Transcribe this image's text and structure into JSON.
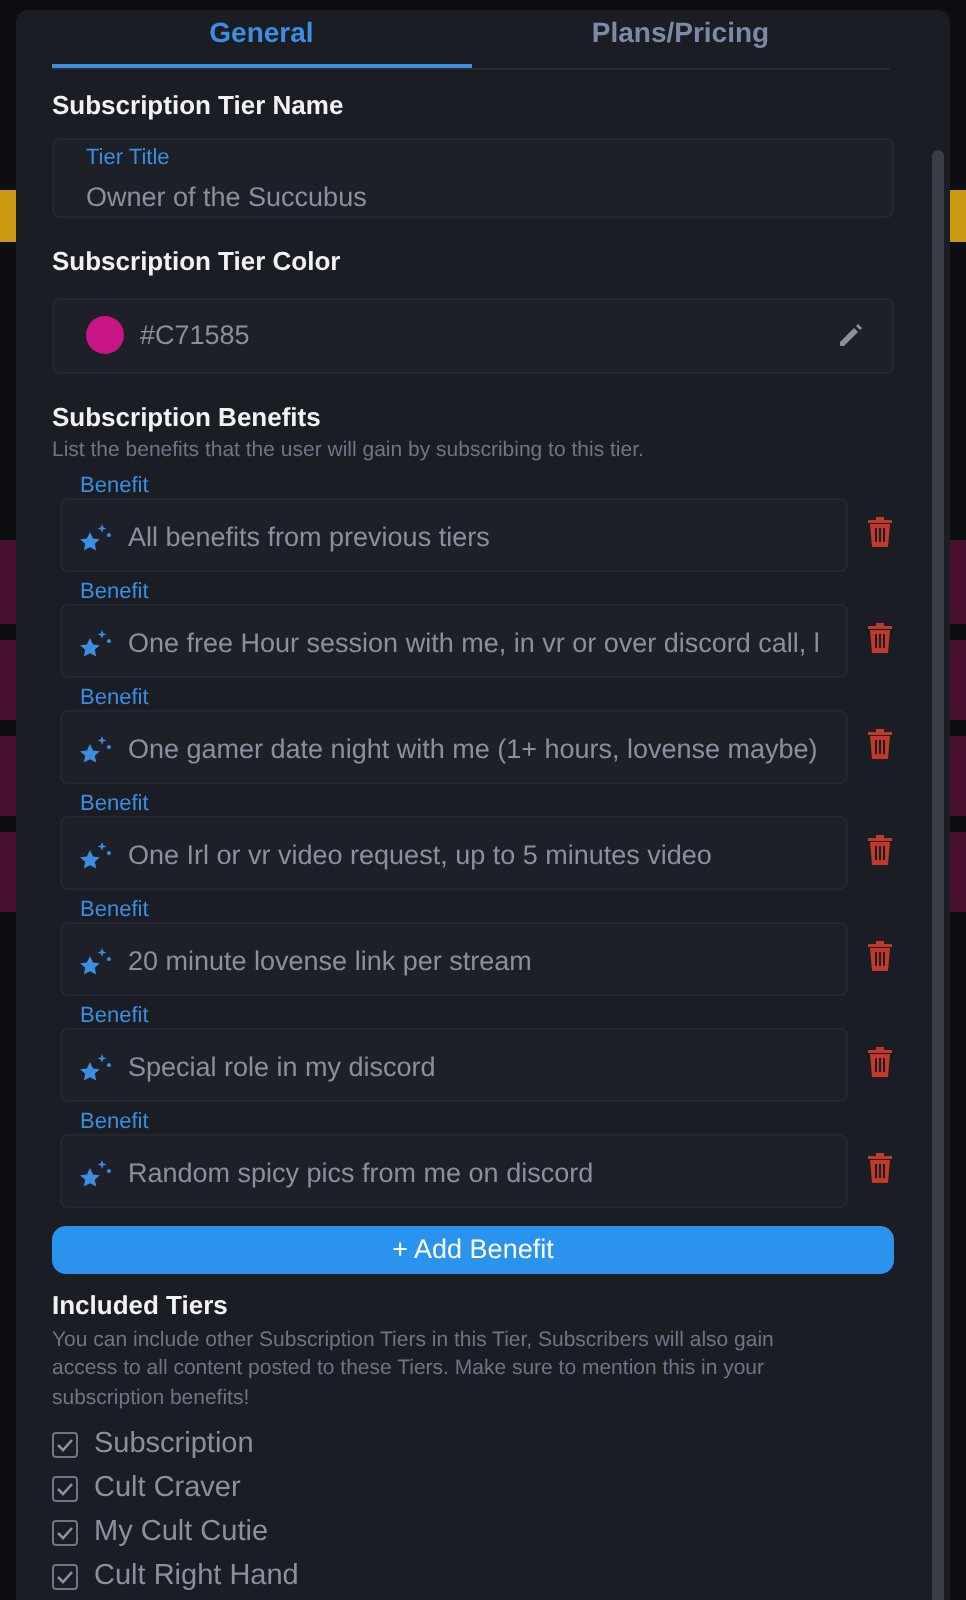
{
  "tabs": [
    {
      "label": "General",
      "selected": true
    },
    {
      "label": "Plans/Pricing",
      "selected": false
    }
  ],
  "tier_name": {
    "heading": "Subscription Tier Name",
    "field_label": "Tier Title",
    "value": "Owner of the Succubus"
  },
  "tier_color": {
    "heading": "Subscription Tier Color",
    "value": "#C71585",
    "color": "#c71585"
  },
  "benefits": {
    "heading": "Subscription Benefits",
    "hint": "List the benefits that the user will gain by subscribing to this tier.",
    "items": [
      {
        "label": "Benefit",
        "value": "All benefits from previous tiers"
      },
      {
        "label": "Benefit",
        "value": "One free Hour session with me, in vr or over discord call, l"
      },
      {
        "label": "Benefit",
        "value": "One gamer date night with me (1+ hours, lovense maybe)"
      },
      {
        "label": "Benefit",
        "value": "One Irl or vr video request, up to 5 minutes video"
      },
      {
        "label": "Benefit",
        "value": "20 minute lovense link per stream"
      },
      {
        "label": "Benefit",
        "value": "Special role in my discord"
      },
      {
        "label": "Benefit",
        "value": "Random spicy pics from me on discord"
      }
    ],
    "add_button": "+ Add Benefit"
  },
  "included_tiers": {
    "heading": "Included Tiers",
    "hint": "You can include other Subscription Tiers in this Tier, Subscribers will also gain access to all content posted to these Tiers. Make sure to mention this in your subscription benefits!",
    "items": [
      {
        "label": "Subscription",
        "checked": true
      },
      {
        "label": "Cult Craver",
        "checked": true
      },
      {
        "label": "My Cult Cutie",
        "checked": true
      },
      {
        "label": "Cult Right Hand",
        "checked": true
      }
    ]
  }
}
